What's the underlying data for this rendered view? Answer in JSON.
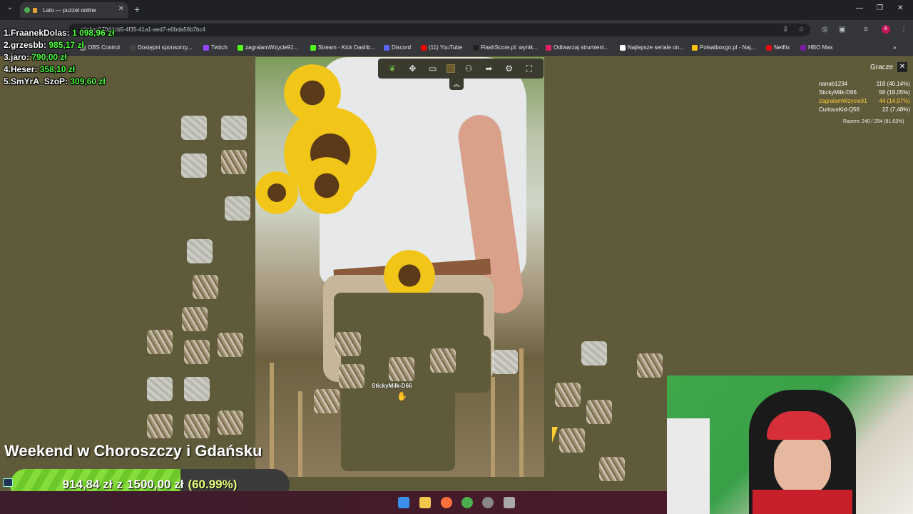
{
  "browser": {
    "tab_title": "Lato — puzzel online",
    "url": "...pl/play/17044cb5-4f35-41a1-aed7-e0bda56b7bc4",
    "bookmarks": [
      {
        "label": "OBS Control",
        "color": "#888888"
      },
      {
        "label": "Dostępni sponsorzy...",
        "color": "#444444"
      },
      {
        "label": "Twitch",
        "color": "#9146ff"
      },
      {
        "label": "zagralamWzycie91...",
        "color": "#53fc18"
      },
      {
        "label": "Stream - Kick Dashb...",
        "color": "#53fc18"
      },
      {
        "label": "Discord",
        "color": "#5865f2"
      },
      {
        "label": "(11) YouTube",
        "color": "#ff0000"
      },
      {
        "label": "FlashScore.pl: wynik...",
        "color": "#222222"
      },
      {
        "label": "Odtwarzaj strumieni...",
        "color": "#e91e63"
      },
      {
        "label": "Najlepsze seriale on...",
        "color": "#ffffff"
      },
      {
        "label": "Polsatboxgo.pl - Naj...",
        "color": "#ffc107"
      },
      {
        "label": "Netflix",
        "color": "#e50914"
      },
      {
        "label": "HBO Max",
        "color": "#7b1fa2"
      }
    ],
    "bookmarks_more": "»",
    "profile_initial": "k"
  },
  "leaderboard": [
    {
      "rank_name": "1.FraanekDolas:",
      "amount": "1 098,96 zł"
    },
    {
      "rank_name": "2.grzesbb:",
      "amount": "985,17 zł"
    },
    {
      "rank_name": "3.jaro:",
      "amount": "790,00 zł"
    },
    {
      "rank_name": "4.Heser:",
      "amount": "358,10 zł"
    },
    {
      "rank_name": "5.SmYrA_SzoP:",
      "amount": "309,60 zł"
    }
  ],
  "players": {
    "title": "Gracze",
    "close": "✕",
    "rows": [
      {
        "name": "nanab1234",
        "score": "118 (40,14%)"
      },
      {
        "name": "StickyMilk-D66",
        "score": "56 (19,05%)"
      },
      {
        "name": "zagralamWzycie91",
        "score": "44 (14,97%)"
      },
      {
        "name": "CuriousKid-Q56",
        "score": "22 (7,48%)"
      }
    ],
    "total": "Razem: 240 / 294 (81,63%)"
  },
  "cursor": {
    "label": "StickyMilk-D66"
  },
  "overlay": {
    "event_title": "Weekend w Choroszczy i Gdańsku",
    "goal_current": "914,84 zł",
    "goal_separator": "z",
    "goal_target": "1500,00 zł",
    "goal_percent_text": "(60.99%)",
    "goal_fraction": 0.6099
  },
  "toolbar_icons": [
    "leaf-icon",
    "puzzle-icon",
    "image-icon",
    "color-swatch",
    "players-icon",
    "share-icon",
    "settings-icon",
    "fullscreen-icon"
  ]
}
